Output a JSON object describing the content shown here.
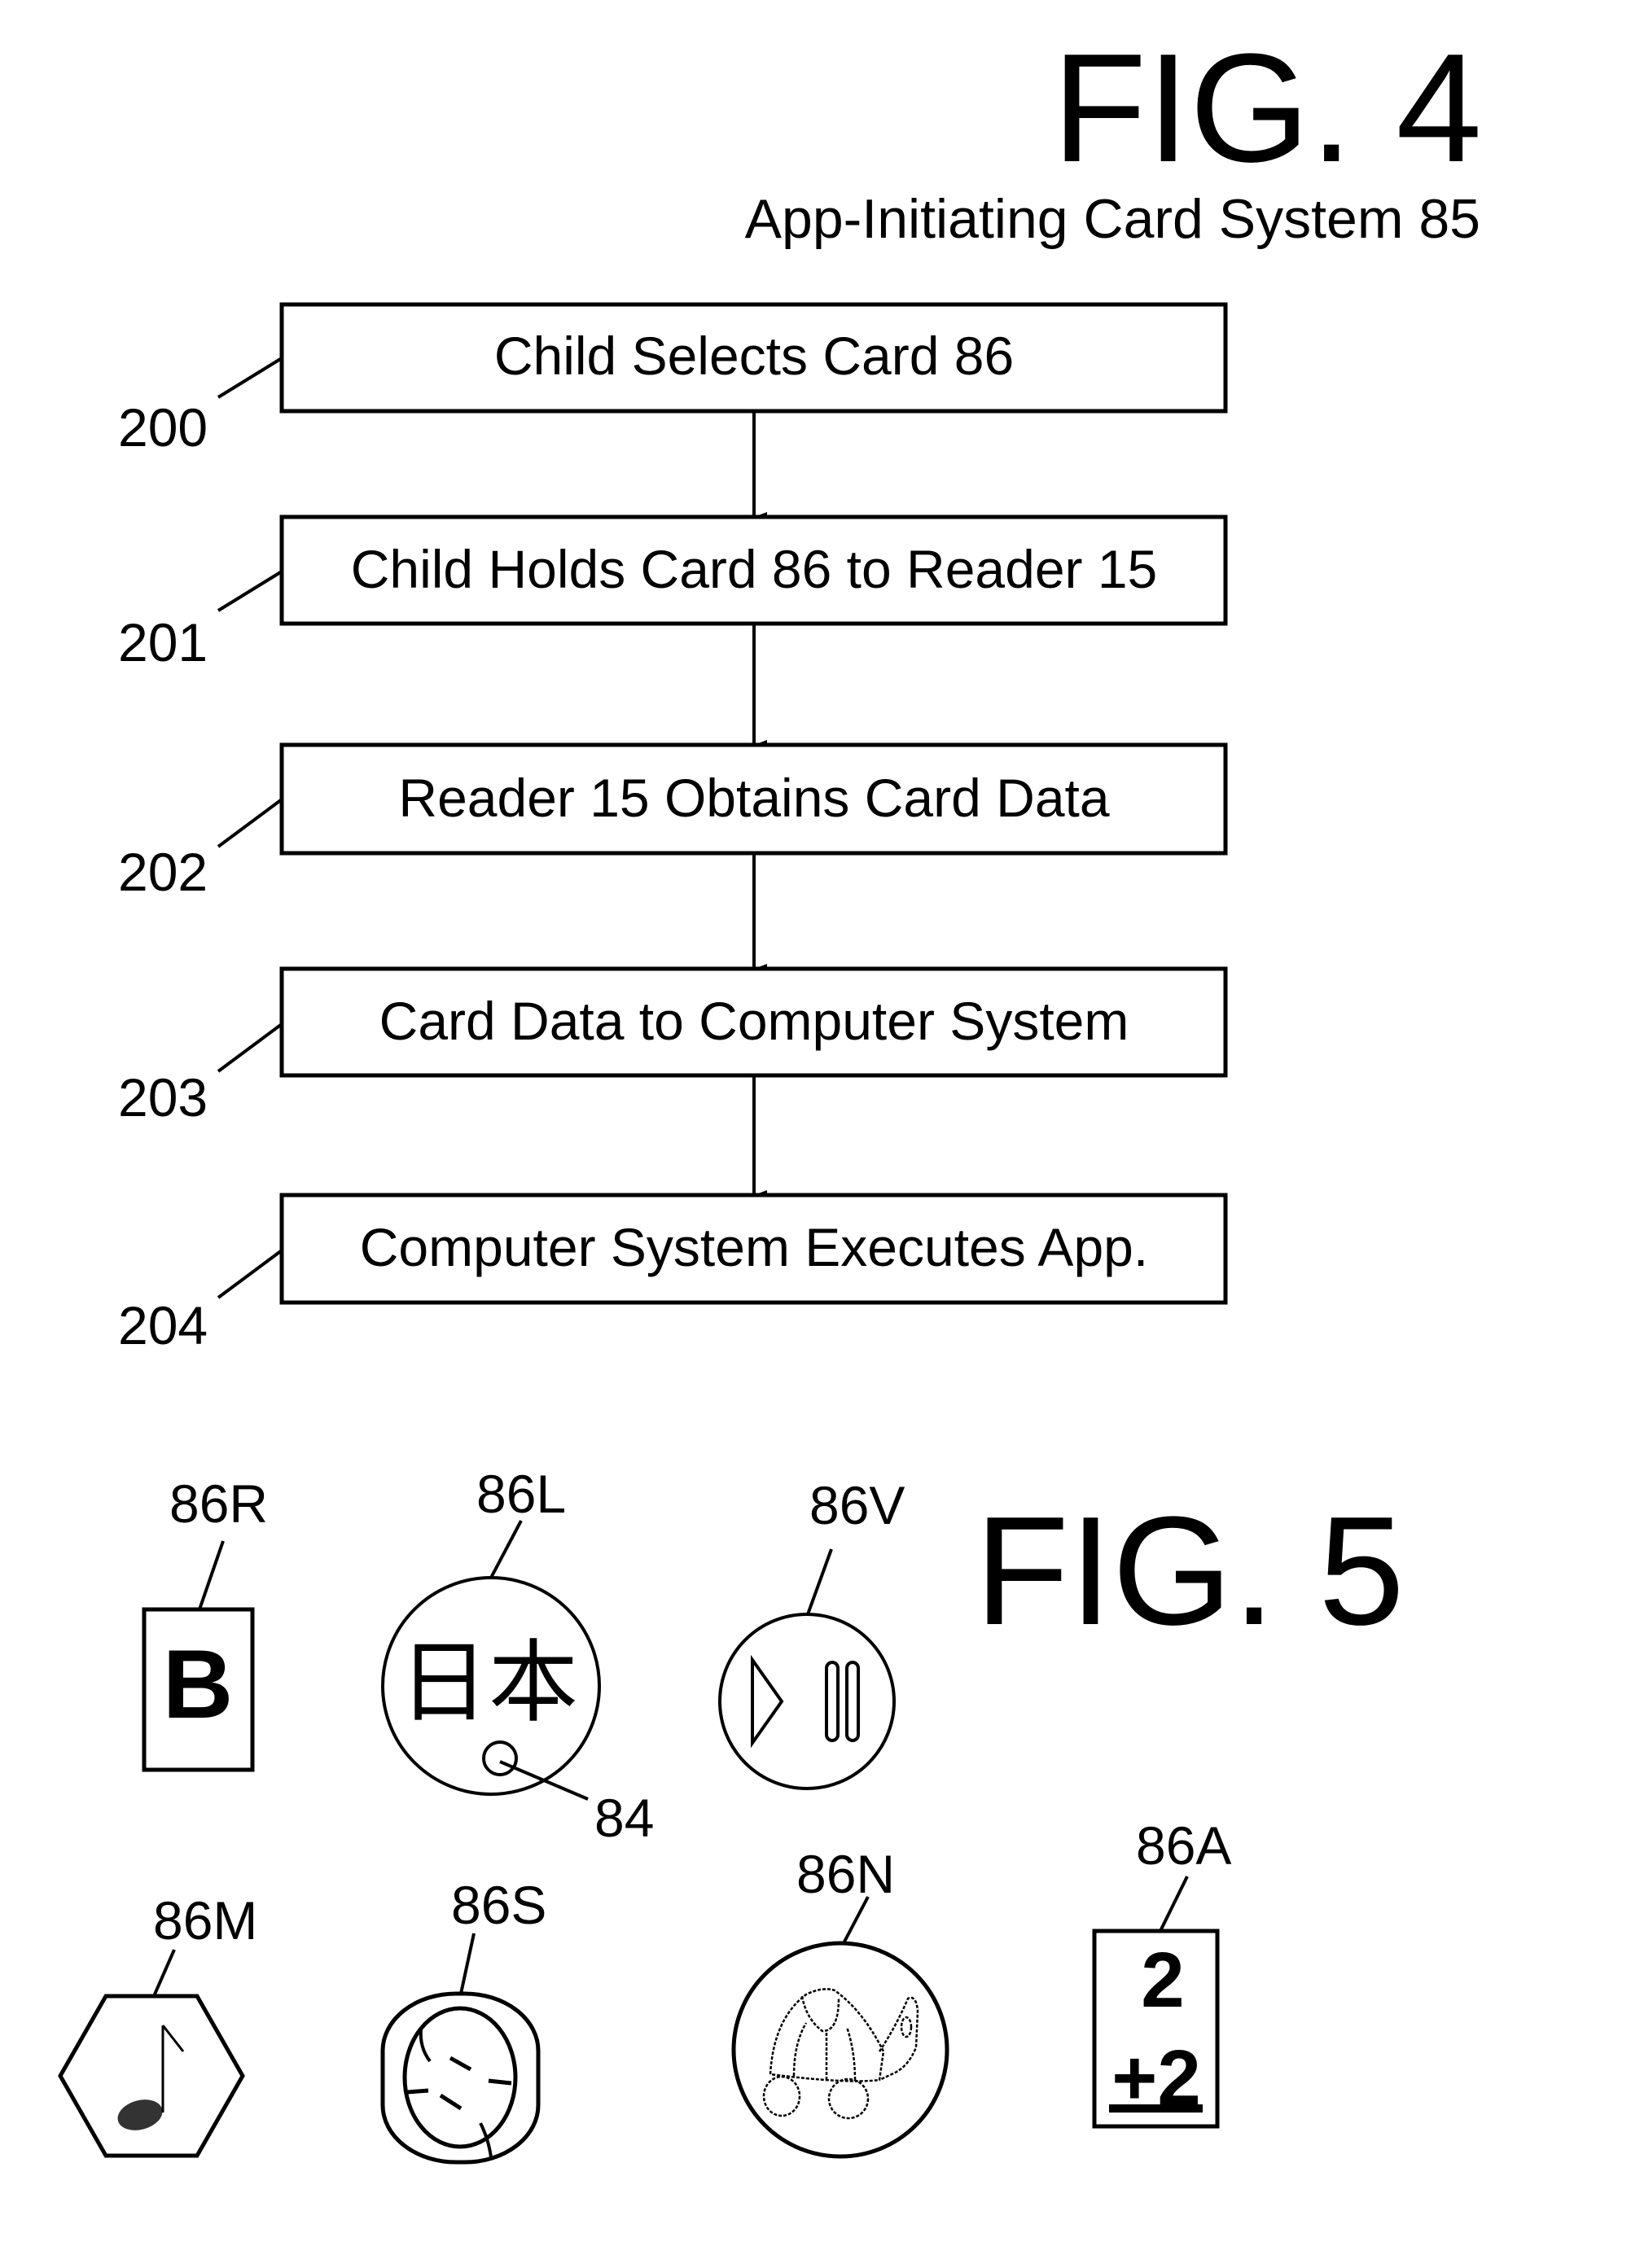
{
  "fig4": {
    "title": "FIG. 4",
    "subtitle": "App-Initiating Card System 85",
    "steps": [
      {
        "ref": "200",
        "label": "Child Selects Card 86"
      },
      {
        "ref": "201",
        "label": "Child Holds Card 86 to Reader 15"
      },
      {
        "ref": "202",
        "label": "Reader 15 Obtains Card Data"
      },
      {
        "ref": "203",
        "label": "Card Data to Computer System"
      },
      {
        "ref": "204",
        "label": "Computer System Executes App."
      }
    ]
  },
  "fig5": {
    "title": "FIG. 5",
    "cards": [
      {
        "ref": "86R",
        "shape": "rectangle",
        "content": "B",
        "icon": "letter-b-icon"
      },
      {
        "ref": "86L",
        "shape": "circle",
        "content": "日本",
        "icon": "kanji-icon",
        "sub_ref": "84"
      },
      {
        "ref": "86V",
        "shape": "circle",
        "content": "",
        "icon": "play-pause-icon"
      },
      {
        "ref": "86M",
        "shape": "hexagon",
        "content": "",
        "icon": "music-note-icon"
      },
      {
        "ref": "86S",
        "shape": "rounded-rectangle",
        "content": "",
        "icon": "baseball-icon"
      },
      {
        "ref": "86N",
        "shape": "circle",
        "content": "",
        "icon": "turtle-icon"
      },
      {
        "ref": "86A",
        "shape": "rectangle",
        "content_top": "2",
        "content_bottom": "+2",
        "icon": "addition-icon"
      }
    ]
  }
}
